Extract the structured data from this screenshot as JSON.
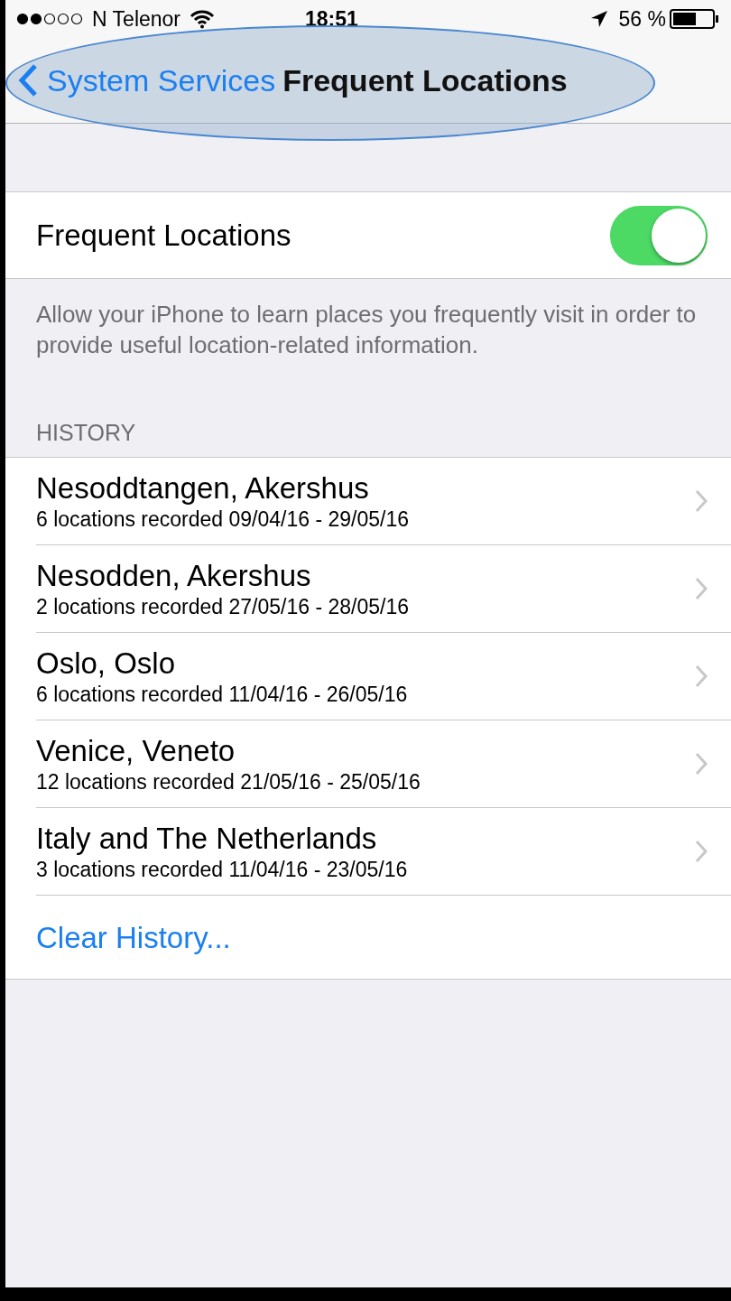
{
  "status_bar": {
    "carrier": "N Telenor",
    "time": "18:51",
    "battery": "56 %"
  },
  "nav": {
    "back": "System Services",
    "title": "Frequent Locations",
    "highlighted": true
  },
  "toggle": {
    "label": "Frequent Locations",
    "on": true
  },
  "description": "Allow your iPhone to learn places you frequently visit in order to provide useful location-related information.",
  "history": {
    "header": "HISTORY",
    "rows": [
      {
        "title": "Nesoddtangen, Akershus",
        "subtitle": "6 locations recorded 09/04/16 - 29/05/16"
      },
      {
        "title": "Nesodden, Akershus",
        "subtitle": "2 locations recorded 27/05/16 - 28/05/16"
      },
      {
        "title": "Oslo, Oslo",
        "subtitle": "6 locations recorded 11/04/16 - 26/05/16"
      },
      {
        "title": "Venice, Veneto",
        "subtitle": "12 locations recorded 21/05/16 - 25/05/16"
      },
      {
        "title": "Italy and The Netherlands",
        "subtitle": "3 locations recorded 11/04/16 - 23/05/16"
      }
    ],
    "clear": "Clear History..."
  }
}
